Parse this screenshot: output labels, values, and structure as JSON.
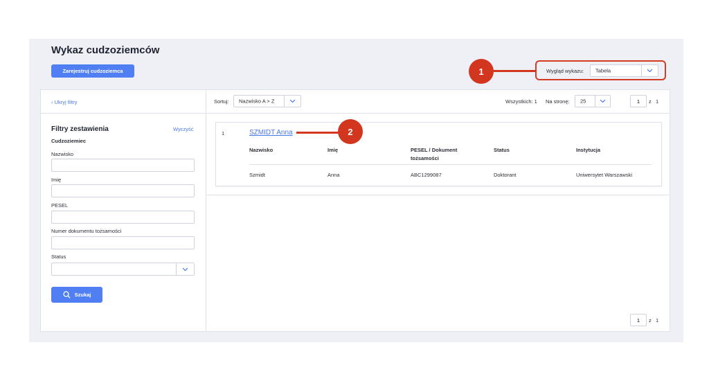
{
  "page": {
    "title": "Wykaz cudzoziemców",
    "register_button": "Zarejestruj cudzoziemca"
  },
  "view": {
    "label": "Wygląd wykazu:",
    "selected": "Tabela"
  },
  "annotations": {
    "badge1": "1",
    "badge2": "2",
    "color": "#d2361f"
  },
  "filters": {
    "hide_link": "‹ Ukryj filtry",
    "title": "Filtry zestawienia",
    "clear_link": "Wyczyść",
    "section": "Cudzoziemiec",
    "fields": [
      {
        "label": "Nazwisko",
        "value": ""
      },
      {
        "label": "Imię",
        "value": ""
      },
      {
        "label": "PESEL",
        "value": ""
      },
      {
        "label": "Numer dokumentu tożsamości",
        "value": ""
      }
    ],
    "status_label": "Status",
    "status_value": "",
    "search_button": "Szukaj"
  },
  "toolbar": {
    "sort_label": "Sortuj:",
    "sort_value": "Nazwisko A > Z",
    "total_label": "Wszystkich: 1",
    "per_page_label": "Na stronę:",
    "per_page_value": "25",
    "page_current": "1",
    "page_of": "z",
    "page_total": "1"
  },
  "results": {
    "columns": [
      "Nazwisko",
      "Imię",
      "PESEL / Dokument tożsamości",
      "Status",
      "Instytucja"
    ],
    "items": [
      {
        "index": "1",
        "full_name": "SZMIDT Anna",
        "values": [
          "Szmidt",
          "Anna",
          "ABC1299087",
          "Doktorant",
          "Uniwersytet Warszawski"
        ]
      }
    ]
  },
  "colors": {
    "primary": "#4f7ff3",
    "link": "#4a78e6",
    "background": "#eef0f6"
  }
}
